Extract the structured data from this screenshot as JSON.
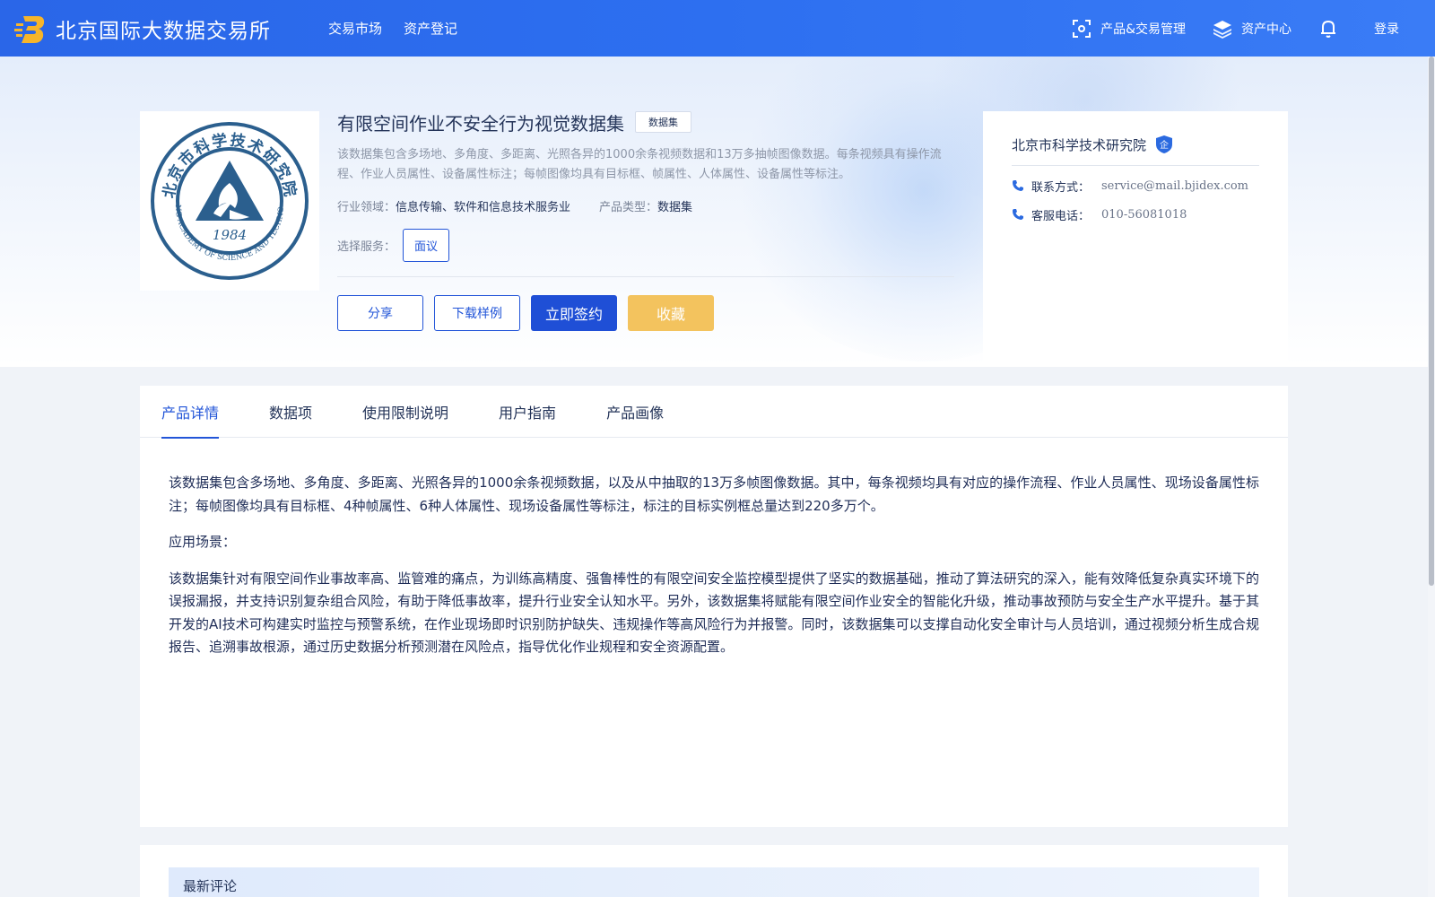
{
  "header": {
    "brand_title": "北京国际大数据交易所",
    "nav_links": [
      "交易市场",
      "资产登记"
    ],
    "product_mgmt_label": "产品&交易管理",
    "asset_center_label": "资产中心",
    "login_label": "登录"
  },
  "product": {
    "logo": {
      "top_text": "北京市科学技术研究院",
      "bottom_text": "BEIJING ACADEMY OF SCIENCE AND TECHNOLOGY",
      "year": "1984"
    },
    "title": "有限空间作业不安全行为视觉数据集",
    "tag": "数据集",
    "description": "该数据集包含多场地、多角度、多距离、光照各异的1000余条视频数据和13万多抽帧图像数据。每条视频具有操作流程、作业人员属性、设备属性标注；每帧图像均具有目标框、帧属性、人体属性、设备属性等标注。",
    "industry_label": "行业领域：",
    "industry_value": "信息传输、软件和信息技术服务业",
    "type_label": "产品类型：",
    "type_value": "数据集",
    "service_label": "选择服务：",
    "service_option": "面议",
    "buttons": {
      "share": "分享",
      "download": "下载样例",
      "sign": "立即签约",
      "favorite": "收藏"
    }
  },
  "organization": {
    "name": "北京市科学技术研究院",
    "badge": "企",
    "contact_label": "联系方式：",
    "contact_value": "service@mail.bjidex.com",
    "phone_label": "客服电话：",
    "phone_value": "010-56081018"
  },
  "tabs": [
    "产品详情",
    "数据项",
    "使用限制说明",
    "用户指南",
    "产品画像"
  ],
  "active_tab": 0,
  "detail": {
    "p1": "该数据集包含多场地、多角度、多距离、光照各异的1000余条视频数据，以及从中抽取的13万多帧图像数据。其中，每条视频均具有对应的操作流程、作业人员属性、现场设备属性标注；每帧图像均具有目标框、4种帧属性、6种人体属性、现场设备属性等标注，标注的目标实例框总量达到220多万个。",
    "p2": "应用场景：",
    "p3": "该数据集针对有限空间作业事故率高、监管难的痛点，为训练高精度、强鲁棒性的有限空间安全监控模型提供了坚实的数据基础，推动了算法研究的深入，能有效降低复杂真实环境下的误报漏报，并支持识别复杂组合风险，有助于降低事故率，提升行业安全认知水平。另外，该数据集将赋能有限空间作业安全的智能化升级，推动事故预防与安全生产水平提升。基于其开发的AI技术可构建实时监控与预警系统，在作业现场即时识别防护缺失、违规操作等高风险行为并报警。同时，该数据集可以支撑自动化安全审计与人员培训，通过视频分析生成合规报告、追溯事故根源，通过历史数据分析预测潜在风险点，指导优化作业规程和安全资源配置。"
  },
  "comments": {
    "title": "最新评论"
  },
  "colors": {
    "primary": "#1f4fd6",
    "accent_yellow": "#f3c35e",
    "nav_bg": "#2d6ff0"
  }
}
